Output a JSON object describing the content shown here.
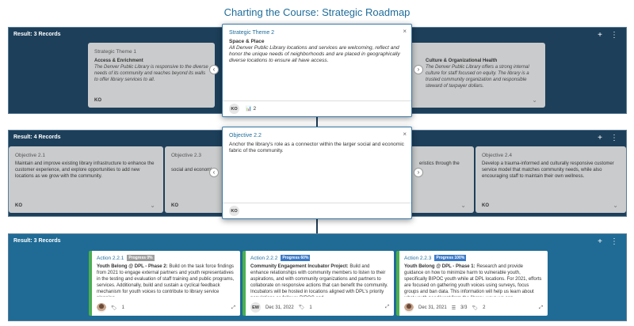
{
  "page_title": "Charting the Course: Strategic Roadmap",
  "bands": [
    {
      "label": "Result: 3 Records"
    },
    {
      "label": "Result: 4 Records"
    },
    {
      "label": "Result: 3 Records"
    }
  ],
  "tools": {
    "add": "+",
    "more": "⋮"
  },
  "themes": [
    {
      "title": "Strategic Theme 1",
      "heading": "Access & Enrichment",
      "text": "The Denver Public Library is responsive to the diverse needs of its community and reaches beyond its walls to offer library services to all.",
      "owner": "KO"
    },
    {
      "title": "",
      "heading": "Culture & Organizational Health",
      "text": "The Denver Public Library offers a strong internal culture for staff focused on equity. The library is a trusted community organization and responsible steward of taxpayer dollars.",
      "owner": ""
    }
  ],
  "theme_popup": {
    "title": "Strategic Theme 2",
    "heading": "Space & Place",
    "text": "All Denver Public Library locations and services are welcoming, reflect and honor the unique needs of neighborhoods and are placed in geographically diverse locations to ensure all have access.",
    "owner": "KO",
    "count": "2"
  },
  "objectives": [
    {
      "title": "Objective 2.1",
      "text": "Maintain and improve existing library infrastructure to enhance the customer experience, and explore opportunities to add new locations as we grow with the community.",
      "owner": "KO"
    },
    {
      "title": "Objective 2.3",
      "text": "social and economic",
      "owner": "KO"
    },
    {
      "title": "",
      "text": "eristics through the",
      "owner": ""
    },
    {
      "title": "Objective 2.4",
      "text": "Develop a trauma-informed and culturally responsive customer service model that matches community needs, while also encouraging staff to maintain their own wellness.",
      "owner": "KO"
    }
  ],
  "objective_popup": {
    "title": "Objective 2.2",
    "text": "Anchor the library's role as a connector within the larger social and economic fabric of the community.",
    "owner": "KO"
  },
  "actions": [
    {
      "title": "Action 2.2.1",
      "progress": "Progress 0%",
      "heading": "Youth Belong @ DPL - Phase 2:",
      "text": "Build on the task force findings from 2021 to engage external partners and youth representatives in the testing and evaluation of staff training and public programs, services. Additionally, build and sustain a cyclical feedback mechanism for youth voices to contribute to library service planning.",
      "owner": "",
      "date": "",
      "tags": "1",
      "tasks": "",
      "color": "#4caf50"
    },
    {
      "title": "Action 2.2.2",
      "progress": "Progress 60%",
      "heading": "Community Engagement Incubator Project:",
      "text": "Build and enhance relationships with community members to listen to their aspirations, and with community organizations and partners to collaborate on responsive actions that can benefit the community. Incubators will be hosted in locations aligned with DPL's priority populations as follows: BIPOC and",
      "owner": "EW",
      "date": "Dec 31, 2022",
      "tags": "1",
      "tasks": "",
      "color": "#4caf50"
    },
    {
      "title": "Action 2.2.3",
      "progress": "Progress 100%",
      "heading": "Youth Belong @ DPL - Phase 1:",
      "text": "Research and provide guidance on how to minimize harm to vulnerable youth, specifically BIPOC youth while at DPL locations. For 2021, efforts are focused on gathering youth voices using surveys, focus groups and ban data. This information will help us learn about what youth need/want from the library, ways we can",
      "owner": "",
      "date": "Dec 31, 2021",
      "tags": "2",
      "tasks": "3/3",
      "color": "#4caf50"
    }
  ],
  "icons": {
    "close": "×",
    "prev": "‹",
    "next": "›",
    "chevron": "⌄",
    "expand": "⤢",
    "tag": "🏷",
    "chart": "📊"
  }
}
